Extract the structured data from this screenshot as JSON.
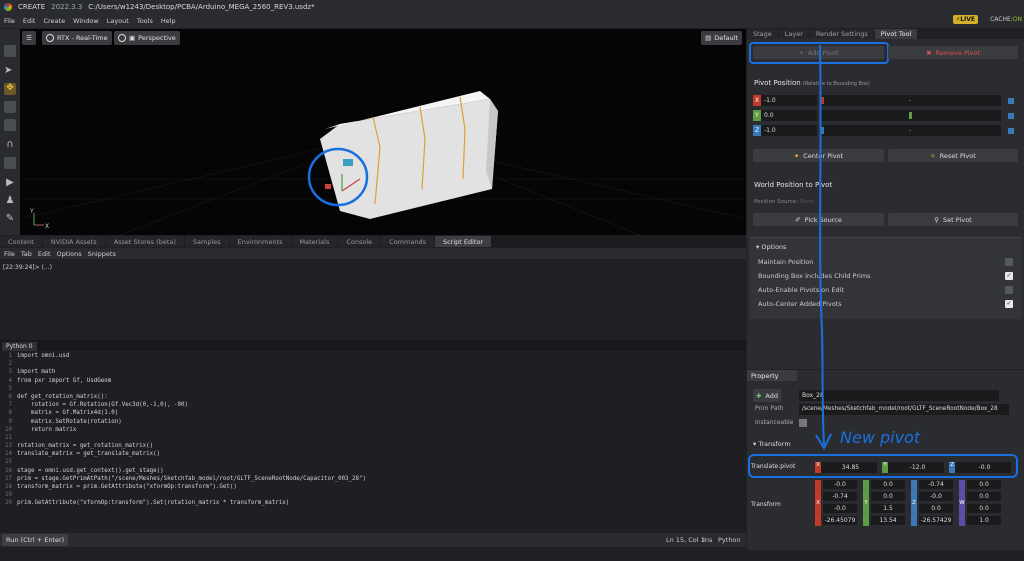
{
  "titlebar": {
    "app": "CREATE",
    "version": "2022.3.3",
    "path": "C:/Users/w1243/Desktop/PCBA/Arduino_MEGA_2560_REV3.usdz*",
    "live": "LIVE",
    "cache_label": "CACHE:",
    "cache_state": "ON"
  },
  "menu": [
    "File",
    "Edit",
    "Create",
    "Window",
    "Layout",
    "Tools",
    "Help"
  ],
  "viewport": {
    "rtx": "RTX - Real-Time",
    "camera": "Perspective",
    "default": "Default",
    "axis_y": "Y",
    "axis_x": "X"
  },
  "bottom_tabs": [
    "Content",
    "NVIDIA Assets",
    "Asset Stores (beta)",
    "Samples",
    "Environments",
    "Materials",
    "Console",
    "Commands",
    "Script Editor"
  ],
  "script_menu": [
    "File",
    "Tab",
    "Edit",
    "Options",
    "Snippets"
  ],
  "output_line": "[22:39:24]> (...)",
  "python_tab": "Python 0",
  "code": [
    {
      "n": "1",
      "t": "import omni.usd"
    },
    {
      "n": "2",
      "t": ""
    },
    {
      "n": "3",
      "t": "import math"
    },
    {
      "n": "4",
      "t": "from pxr import Gf, UsdGeom"
    },
    {
      "n": "5",
      "t": ""
    },
    {
      "n": "6",
      "t": "def get_rotation_matrix():"
    },
    {
      "n": "7",
      "t": "    rotation = Gf.Rotation(Gf.Vec3d(0,-1,0), -90)"
    },
    {
      "n": "8",
      "t": "    matrix = Gf.Matrix4d(1.0)"
    },
    {
      "n": "9",
      "t": "    matrix.SetRotate(rotation)"
    },
    {
      "n": "10",
      "t": "    return matrix"
    },
    {
      "n": "11",
      "t": ""
    },
    {
      "n": "13",
      "t": "rotation_matrix = get_rotation_matrix()"
    },
    {
      "n": "14",
      "t": "translate_matrix = get_translate_matrix()"
    },
    {
      "n": "15",
      "t": ""
    },
    {
      "n": "16",
      "t": "stage = omni.usd.get_context().get_stage()"
    },
    {
      "n": "17",
      "t": "prim = stage.GetPrimAtPath(\"/scene/Meshes/Sketchfab_model/root/GLTF_SceneRootNode/Capacitor_003_28\")"
    },
    {
      "n": "18",
      "t": "transform_matrix = prim.GetAttribute(\"xformOp:transform\").Get()"
    },
    {
      "n": "19",
      "t": ""
    },
    {
      "n": "20",
      "t": "prim.GetAttribute(\"xformOp:transform\").Set(rotation_matrix * transform_matrix)"
    }
  ],
  "status": {
    "run": "Run (Ctrl + Enter)",
    "pos": "Ln 15, Col 1",
    "ins": "Ins",
    "lang": "Python"
  },
  "right_tabs": [
    "Stage",
    "Layer",
    "Render Settings",
    "Pivot Tool"
  ],
  "pivot": {
    "add": "Add Pivot",
    "remove": "Remove Pivot",
    "position_title": "Pivot Position",
    "position_sub": "(Relative to Bounding Box)",
    "rows": [
      {
        "axis": "X",
        "value": "-1.0",
        "fill": 0.0
      },
      {
        "axis": "Y",
        "value": "0.0",
        "fill": 0.5
      },
      {
        "axis": "Z",
        "value": "-1.0",
        "fill": 0.0
      }
    ],
    "center": "Center Pivot",
    "reset": "Reset Pivot",
    "world_title": "World Position to Pivot",
    "source_label": "Position Source:",
    "source_value": "None",
    "pick": "Pick Source",
    "set": "Set Pivot",
    "options_title": "Options",
    "options": [
      {
        "label": "Maintain Position",
        "checked": false
      },
      {
        "label": "Bounding Box includes Child Prims",
        "checked": true
      },
      {
        "label": "Auto-Enable Pivots on Edit",
        "checked": false
      },
      {
        "label": "Auto-Center Added Pivots",
        "checked": true
      }
    ]
  },
  "property": {
    "tab": "Property",
    "add": "Add",
    "name": "Box_28",
    "prim_path_label": "Prim Path",
    "prim_path": "/scene/Meshes/Sketchfab_model/root/GLTF_SceneRootNode/Box_28",
    "instanceable": "Instanceable",
    "transform": "Transform",
    "translate_label": "Translate:pivot",
    "translate": {
      "x": "34.85",
      "y": "-12.0",
      "z": "-0.0"
    },
    "transform_label": "Transform",
    "matrix": [
      [
        "-0.0",
        "0.0",
        "-0.74",
        "0.0"
      ],
      [
        "-0.74",
        "0.0",
        "-0.0",
        "0.0"
      ],
      [
        "-0.0",
        "1.5",
        "0.0",
        "0.0"
      ],
      [
        "-26.45079",
        "13.54",
        "-26.57429",
        "1.0"
      ]
    ],
    "axes": [
      "X",
      "Y",
      "Z",
      "W"
    ]
  },
  "annotation": "New pivot",
  "colors": {
    "x": "#c0392b",
    "y": "#5d9b45",
    "z": "#3b78b8",
    "w": "#5b4ea8",
    "blue_ink": "#1a6fe0",
    "remove": "#e05050"
  }
}
